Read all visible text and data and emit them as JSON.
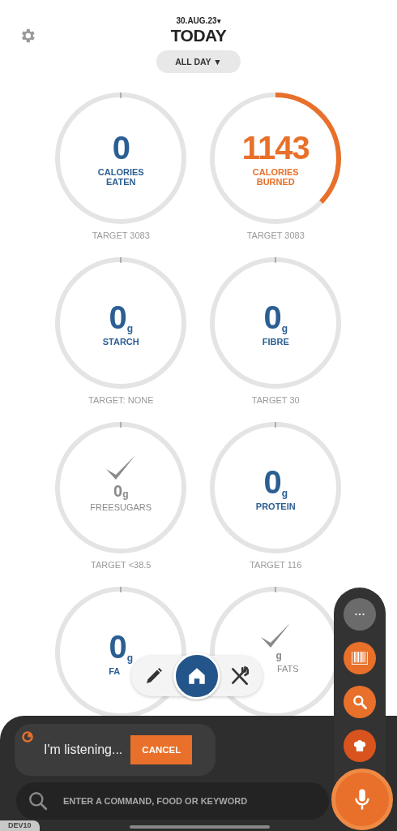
{
  "header": {
    "date": "30.AUG.23",
    "date_caret": "▾",
    "title": "TODAY",
    "period": "ALL DAY",
    "period_caret": "▼"
  },
  "tiles": [
    {
      "kind": "value",
      "value": "0",
      "label": "CALORIES EATEN",
      "color": "#2b5f93",
      "target": "TARGET 3083"
    },
    {
      "kind": "value",
      "value": "1143",
      "label": "CALORIES BURNED",
      "color": "#e8702a",
      "target": "TARGET 3083"
    },
    {
      "kind": "value",
      "value": "0",
      "unit": "g",
      "label": "STARCH",
      "color": "#2b5f93",
      "target": "TARGET: NONE"
    },
    {
      "kind": "value",
      "value": "0",
      "unit": "g",
      "label": "FIBRE",
      "color": "#2b5f93",
      "target": "TARGET 30"
    },
    {
      "kind": "check",
      "value": "0",
      "unit": "g",
      "label": "FREESUGARS",
      "color": "#8a8a8a",
      "target": "TARGET <38.5"
    },
    {
      "kind": "value",
      "value": "0",
      "unit": "g",
      "label": "PROTEIN",
      "color": "#2b5f93",
      "target": "TARGET 116"
    },
    {
      "kind": "value",
      "value": "0",
      "unit": "g",
      "label": "FA",
      "color": "#2b5f93"
    },
    {
      "kind": "check",
      "unit": "g",
      "label": "FATS",
      "color": "#8a8a8a"
    }
  ],
  "nav": [
    {
      "kind": "edit",
      "selected": false
    },
    {
      "kind": "home",
      "selected": true
    },
    {
      "kind": "food",
      "selected": false
    }
  ],
  "quick_actions": [
    {
      "kind": "more"
    },
    {
      "kind": "barcode"
    },
    {
      "kind": "search"
    },
    {
      "kind": "chef"
    }
  ],
  "assistant": {
    "message": "I'm listening...",
    "cancel": "CANCEL",
    "placeholder": "ENTER A COMMAND, FOOD OR KEYWORD",
    "env": "DEV10"
  }
}
